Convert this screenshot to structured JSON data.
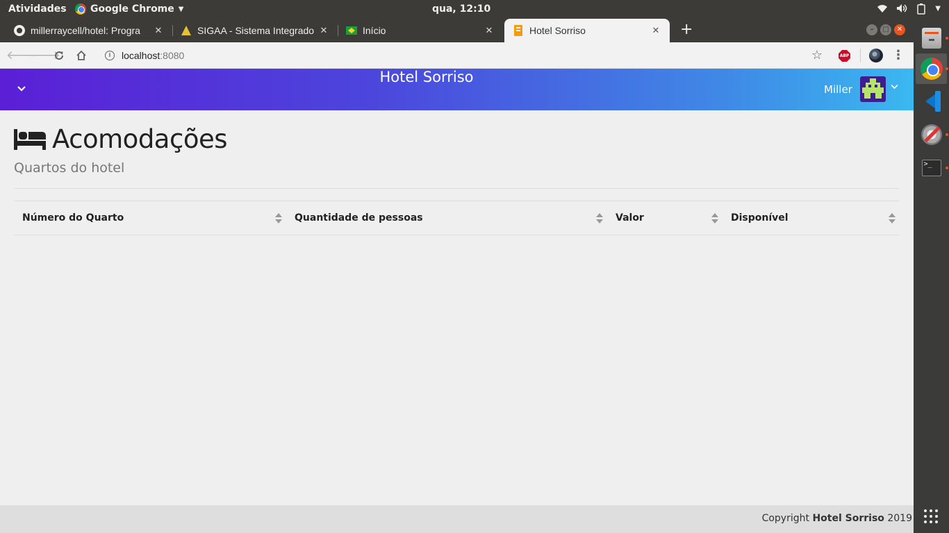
{
  "system_bar": {
    "activities": "Atividades",
    "app_name": "Google Chrome",
    "clock": "qua, 12:10"
  },
  "browser": {
    "tabs": [
      {
        "title": "millerraycell/hotel: Progra",
        "favicon": "github-icon"
      },
      {
        "title": "SIGAA - Sistema Integrado",
        "favicon": "sigaa-icon"
      },
      {
        "title": "Início",
        "favicon": "brazil-flag-icon"
      },
      {
        "title": "Hotel Sorriso",
        "favicon": "hotel-icon",
        "active": true
      }
    ],
    "url_host": "localhost",
    "url_port": ":8080",
    "abp_label": "ABP"
  },
  "app": {
    "brand": "Hotel Sorriso",
    "user_name": "Miller",
    "page_title": "Acomodações",
    "page_subtitle": "Quartos do hotel",
    "table": {
      "columns": [
        "Número do Quarto",
        "Quantidade de pessoas",
        "Valor",
        "Disponível"
      ],
      "rows": []
    },
    "footer": {
      "prefix": "Copyright ",
      "brand": "Hotel Sorriso",
      "year": " 2019"
    }
  },
  "colors": {
    "header_gradient_start": "#5b1fd6",
    "header_gradient_end": "#3ab8f0",
    "page_background": "#efefef",
    "avatar_background": "#3b1e8f",
    "avatar_pixels": "#b6e36a"
  }
}
